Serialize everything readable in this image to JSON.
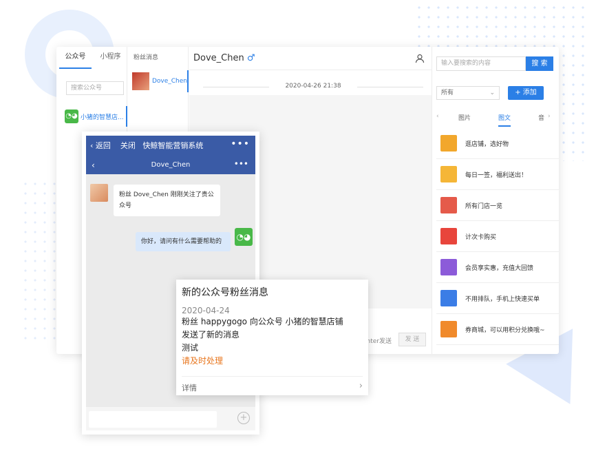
{
  "col1": {
    "tab_public": "公众号",
    "tab_mini": "小程序",
    "search_placeholder": "搜索公众号",
    "account_name": "小猪的智慧店..."
  },
  "col2": {
    "header": "粉丝消息",
    "fan_name": "Dove_Chen"
  },
  "chat": {
    "title": "Dove_Chen",
    "gender_icon": "♂",
    "time": "2020-04-26 21:38",
    "enter_hint": "nter发送",
    "send_label": "发 送"
  },
  "right": {
    "search_placeholder": "输入要搜索的内容",
    "search_button": "搜 索",
    "filter_value": "所有",
    "add_button": "+ 添加",
    "tabs": [
      "图片",
      "图文",
      "音"
    ],
    "active_tab": "图文",
    "items": [
      {
        "label": "逛店铺，选好物",
        "color": "#f2a72c"
      },
      {
        "label": "每日一签，福利送出！",
        "color": "#f5b637"
      },
      {
        "label": "所有门店一览",
        "color": "#e55a4a"
      },
      {
        "label": "计次卡购买",
        "color": "#e8453c"
      },
      {
        "label": "会员享实惠，充值大回馈",
        "color": "#8c5bd9"
      },
      {
        "label": "不用排队，手机上快速买单",
        "color": "#3b7de6"
      },
      {
        "label": "券商城，可以用积分兑换哦~",
        "color": "#f08a2b"
      }
    ]
  },
  "phone": {
    "back": "返回",
    "close": "关闭",
    "app_title": "快鲸智能营销系统",
    "more": "•••",
    "sub_title": "Dove_Chen",
    "sub_more": "•••",
    "msg_left": "粉丝 Dove_Chen 刚刚关注了贵公众号",
    "msg_right": "你好，请问有什么需要帮助的"
  },
  "notice": {
    "title": "新的公众号粉丝消息",
    "date": "2020-04-24",
    "line1": "粉丝 happygogo 向公众号 小猪的智慧店铺",
    "line2": "发送了新的消息",
    "line3": "测试",
    "urgent": "请及时处理",
    "details": "详情"
  },
  "colors": {
    "accent": "#2b7fe6",
    "header_blue": "#3a5ba6",
    "wechat_green": "#49b848",
    "orange": "#e8761e"
  }
}
